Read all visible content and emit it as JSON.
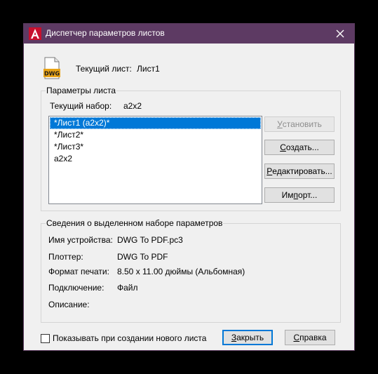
{
  "window": {
    "title": "Диспетчер параметров листов",
    "colors": {
      "titlebar": "#5d3a63",
      "accent": "#0078d7",
      "app_icon": "#c8102e"
    }
  },
  "current": {
    "icon_text": "DWG",
    "label": "Текущий лист:",
    "value": "Лист1"
  },
  "params_group": {
    "title": "Параметры листа",
    "set_label": "Текущий набор:",
    "set_value": "a2x2",
    "list_items": [
      "*Лист1 (a2x2)*",
      "*Лист2*",
      "*Лист3*",
      "a2x2"
    ],
    "selected_index": 0
  },
  "buttons": {
    "set_current": {
      "pre": "",
      "u": "У",
      "post": "становить"
    },
    "new": {
      "pre": "",
      "u": "С",
      "post": "оздать..."
    },
    "modify": {
      "pre": "",
      "u": "Р",
      "post": "едактировать..."
    },
    "import": {
      "pre": "Им",
      "u": "п",
      "post": "орт..."
    }
  },
  "details_group": {
    "title": "Сведения о выделенном наборе параметров",
    "rows": [
      {
        "label": "Имя устройства:",
        "value": "DWG To PDF.pc3"
      },
      {
        "label": "Плоттер:",
        "value": "DWG To PDF"
      },
      {
        "label": "Формат печати:",
        "value": "8.50 x 11.00 дюймы (Альбомная)"
      },
      {
        "label": "Подключение:",
        "value": "Файл"
      },
      {
        "label": "Описание:",
        "value": ""
      }
    ]
  },
  "footer": {
    "checkbox_label": "Показывать при создании нового листа",
    "checkbox_checked": false,
    "close": {
      "pre": "",
      "u": "З",
      "post": "акрыть"
    },
    "help": {
      "pre": "",
      "u": "С",
      "post": "правка"
    }
  }
}
